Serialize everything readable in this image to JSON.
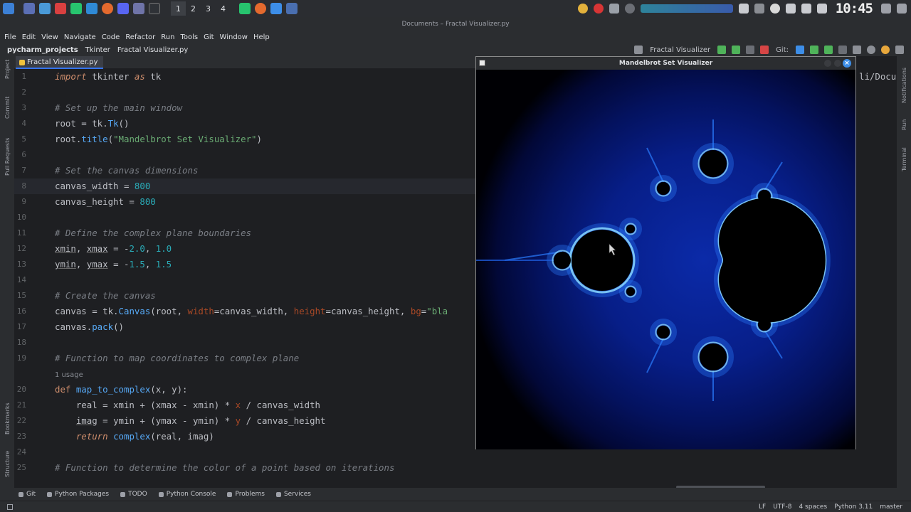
{
  "system": {
    "workspaces": [
      "1",
      "2",
      "3",
      "4"
    ],
    "active_workspace": "1",
    "clock": "10:45"
  },
  "window_title": "Documents – Fractal Visualizer.py",
  "menu": [
    "File",
    "Edit",
    "View",
    "Navigate",
    "Code",
    "Refactor",
    "Run",
    "Tools",
    "Git",
    "Window",
    "Help"
  ],
  "breadcrumb": [
    "pycharm_projects",
    "Tkinter",
    "Fractal Visualizer.py"
  ],
  "run_config": "Fractal Visualizer",
  "git_label": "Git:",
  "editor_tab": "Fractal Visualizer.py",
  "left_tools": [
    "Project",
    "Commit",
    "Pull Requests",
    "Bookmarks",
    "Structure"
  ],
  "right_tools": [
    "Notifications",
    "Run",
    "Terminal"
  ],
  "editor": {
    "current_line": 8,
    "lines": [
      {
        "n": "1",
        "tokens": [
          [
            "kw",
            "import"
          ],
          [
            "plain",
            " tkinter "
          ],
          [
            "kw",
            "as"
          ],
          [
            "plain",
            " tk"
          ]
        ]
      },
      {
        "n": "2",
        "tokens": []
      },
      {
        "n": "3",
        "tokens": [
          [
            "cm",
            "# Set up the main window"
          ]
        ]
      },
      {
        "n": "4",
        "tokens": [
          [
            "plain",
            "root = tk."
          ],
          [
            "call",
            "Tk"
          ],
          [
            "plain",
            "()"
          ]
        ]
      },
      {
        "n": "5",
        "tokens": [
          [
            "plain",
            "root."
          ],
          [
            "call",
            "title"
          ],
          [
            "plain",
            "("
          ],
          [
            "str",
            "\"Mandelbrot Set Visualizer\""
          ],
          [
            "plain",
            ")"
          ]
        ]
      },
      {
        "n": "6",
        "tokens": []
      },
      {
        "n": "7",
        "tokens": [
          [
            "cm",
            "# Set the canvas dimensions"
          ]
        ]
      },
      {
        "n": "8",
        "tokens": [
          [
            "plain",
            "canvas_width = "
          ],
          [
            "num",
            "800"
          ]
        ]
      },
      {
        "n": "9",
        "tokens": [
          [
            "plain",
            "canvas_height = "
          ],
          [
            "num",
            "800"
          ]
        ]
      },
      {
        "n": "10",
        "tokens": []
      },
      {
        "n": "11",
        "tokens": [
          [
            "cm",
            "# Define the complex plane boundaries"
          ]
        ]
      },
      {
        "n": "12",
        "tokens": [
          [
            "ul",
            "xmin"
          ],
          [
            "plain",
            ", "
          ],
          [
            "ul",
            "xmax"
          ],
          [
            "plain",
            " = -"
          ],
          [
            "num",
            "2.0"
          ],
          [
            "plain",
            ", "
          ],
          [
            "num",
            "1.0"
          ]
        ]
      },
      {
        "n": "13",
        "tokens": [
          [
            "ul",
            "ymin"
          ],
          [
            "plain",
            ", "
          ],
          [
            "ul",
            "ymax"
          ],
          [
            "plain",
            " = -"
          ],
          [
            "num",
            "1.5"
          ],
          [
            "plain",
            ", "
          ],
          [
            "num",
            "1.5"
          ]
        ]
      },
      {
        "n": "14",
        "tokens": []
      },
      {
        "n": "15",
        "tokens": [
          [
            "cm",
            "# Create the canvas"
          ]
        ]
      },
      {
        "n": "16",
        "tokens": [
          [
            "plain",
            "canvas = tk."
          ],
          [
            "call",
            "Canvas"
          ],
          [
            "plain",
            "(root, "
          ],
          [
            "kwarg",
            "width"
          ],
          [
            "plain",
            "=canvas_width, "
          ],
          [
            "kwarg",
            "height"
          ],
          [
            "plain",
            "=canvas_height, "
          ],
          [
            "kwarg",
            "bg"
          ],
          [
            "plain",
            "="
          ],
          [
            "str",
            "\"bla"
          ]
        ]
      },
      {
        "n": "17",
        "tokens": [
          [
            "plain",
            "canvas."
          ],
          [
            "call",
            "pack"
          ],
          [
            "plain",
            "()"
          ]
        ]
      },
      {
        "n": "18",
        "tokens": []
      },
      {
        "n": "19",
        "tokens": [
          [
            "cm",
            "# Function to map coordinates to complex plane"
          ]
        ]
      },
      {
        "n": "",
        "hint": "1 usage",
        "tokens": []
      },
      {
        "n": "20",
        "tokens": [
          [
            "def",
            "def "
          ],
          [
            "fn",
            "map_to_complex"
          ],
          [
            "plain",
            "(x, y):"
          ]
        ]
      },
      {
        "n": "21",
        "tokens": [
          [
            "plain",
            "    real = xmin + (xmax - xmin) * "
          ],
          [
            "param",
            "x"
          ],
          [
            "plain",
            " / canvas_width"
          ]
        ]
      },
      {
        "n": "22",
        "tokens": [
          [
            "plain",
            "    "
          ],
          [
            "ul",
            "imag"
          ],
          [
            "plain",
            " = ymin + (ymax - ymin) * "
          ],
          [
            "param",
            "y"
          ],
          [
            "plain",
            " / canvas_height"
          ]
        ]
      },
      {
        "n": "23",
        "tokens": [
          [
            "plain",
            "    "
          ],
          [
            "kw",
            "return"
          ],
          [
            "plain",
            " "
          ],
          [
            "call",
            "complex"
          ],
          [
            "plain",
            "(real, imag)"
          ]
        ]
      },
      {
        "n": "24",
        "tokens": []
      },
      {
        "n": "25",
        "tokens": [
          [
            "cm",
            "# Function to determine the color of a point based on iterations"
          ]
        ]
      }
    ]
  },
  "stub_text": "li/Docu",
  "tk_window": {
    "title": "Mandelbrot Set Visualizer",
    "close_glyph": "×"
  },
  "bottom_tools": [
    "Git",
    "Python Packages",
    "TODO",
    "Python Console",
    "Problems",
    "Services"
  ],
  "status": [
    "LF",
    "UTF-8",
    "4 spaces",
    "Python 3.11",
    "master"
  ],
  "colors": {
    "accent": "#3574f0",
    "fractal_edge": "#2a7dff",
    "fractal_glow": "#8ad8ff"
  }
}
